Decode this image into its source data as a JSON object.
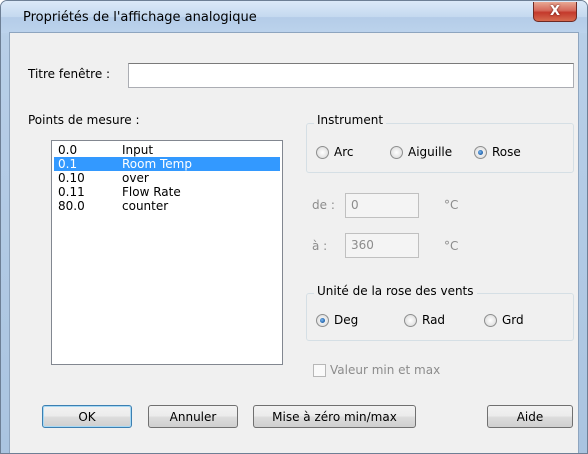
{
  "window": {
    "title": "Propriétés de l'affichage analogique",
    "close_glyph": "X"
  },
  "titre": {
    "label": "Titre fenêtre :",
    "value": ""
  },
  "points": {
    "label": "Points de mesure :",
    "items": [
      {
        "code": "0.0",
        "name": "Input",
        "selected": false
      },
      {
        "code": "0.1",
        "name": "Room Temp",
        "selected": true
      },
      {
        "code": "0.10",
        "name": "over",
        "selected": false
      },
      {
        "code": "0.11",
        "name": "Flow Rate",
        "selected": false
      },
      {
        "code": "80.0",
        "name": "counter",
        "selected": false
      }
    ]
  },
  "instrument": {
    "label": "Instrument",
    "options": [
      "Arc",
      "Aiguille",
      "Rose"
    ],
    "selected": "Rose"
  },
  "range": {
    "from_label": "de :",
    "from_value": "0",
    "from_unit": "°C",
    "to_label": "à :",
    "to_value": "360",
    "to_unit": "°C"
  },
  "rose_unit": {
    "label": "Unité de la rose des vents",
    "options": [
      "Deg",
      "Rad",
      "Grd"
    ],
    "selected": "Deg"
  },
  "minmax": {
    "label": "Valeur min et max",
    "checked": false
  },
  "buttons": {
    "ok": "OK",
    "cancel": "Annuler",
    "reset": "Mise à zéro min/max",
    "help": "Aide"
  }
}
